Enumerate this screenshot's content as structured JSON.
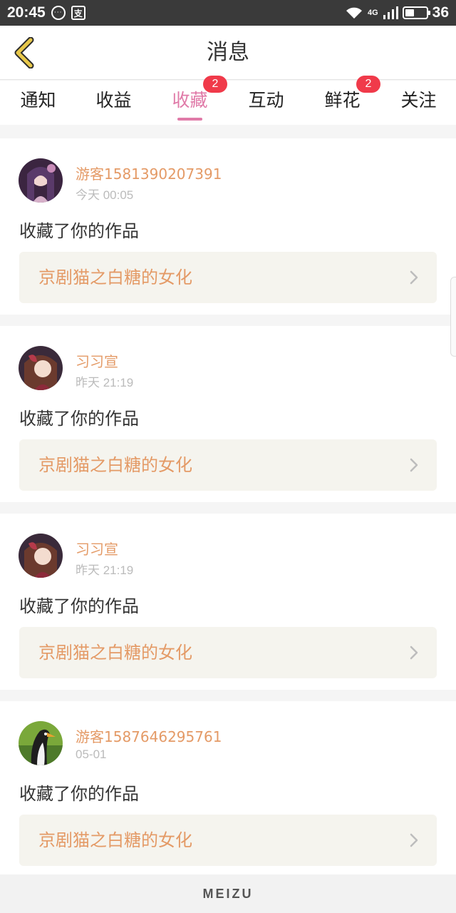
{
  "status_bar": {
    "time": "20:45",
    "message_icon_glyph": "···",
    "pay_icon_glyph": "支",
    "network": "4G",
    "battery_level": "36"
  },
  "header": {
    "title": "消息",
    "back_icon": "chevron-left-icon"
  },
  "tabs": [
    {
      "label": "通知",
      "badge": ""
    },
    {
      "label": "收益",
      "badge": ""
    },
    {
      "label": "收藏",
      "badge": "2",
      "active": true
    },
    {
      "label": "互动",
      "badge": ""
    },
    {
      "label": "鲜花",
      "badge": "2"
    },
    {
      "label": "关注",
      "badge": ""
    }
  ],
  "items": [
    {
      "username": "游客1581390207391",
      "time": "今天 00:05",
      "action": "收藏了你的作品",
      "work_title": "京剧猫之白糖的女化"
    },
    {
      "username": "习习宣",
      "time": "昨天 21:19",
      "action": "收藏了你的作品",
      "work_title": "京剧猫之白糖的女化"
    },
    {
      "username": "习习宣",
      "time": "昨天 21:19",
      "action": "收藏了你的作品",
      "work_title": "京剧猫之白糖的女化"
    },
    {
      "username": "游客1587646295761",
      "time": "05-01",
      "action": "收藏了你的作品",
      "work_title": "京剧猫之白糖的女化"
    }
  ],
  "footer": {
    "brand": "MEIZU"
  },
  "colors": {
    "accent": "#e07aa8",
    "link": "#e49a66",
    "badge": "#f03a4a",
    "back_arrow": "#e8c84a"
  }
}
